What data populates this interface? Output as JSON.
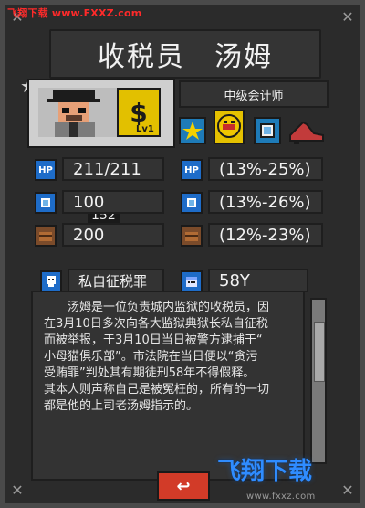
{
  "watermark_top": "飞翔下载 www.FXXZ.com",
  "character": {
    "name": "收税员　汤姆",
    "rank": "中级会计师",
    "hp_badge": "152",
    "level_symbol": "$",
    "level_label": "Lv1"
  },
  "stats_left": [
    {
      "icon": "HP",
      "value": "211/211"
    },
    {
      "icon": "",
      "value": "100"
    },
    {
      "icon": "",
      "value": "200"
    }
  ],
  "stats_right": [
    {
      "icon": "HP",
      "value": "(13%-25%)"
    },
    {
      "icon": "",
      "value": "(13%-26%)"
    },
    {
      "icon": "",
      "value": "(12%-23%)"
    }
  ],
  "crime": {
    "label": "私自征税罪",
    "sentence": "58Y"
  },
  "description": "　　汤姆是一位负责城内监狱的收税员，因\n在3月10日多次向各大监狱典狱长私自征税\n而被举报，于3月10日当日被警方逮捕于“\n小母猫俱乐部”。市法院在当日便以“贪污\n受贿罪”判处其有期徒刑58年不得假释。\n其本人则声称自己是被冤枉的，所有的一切\n都是他的上司老汤姆指示的。",
  "buttons": {
    "back": "↩"
  },
  "watermark_bottom": {
    "brand": "飞翔下载",
    "url": "www.fxxz.com"
  }
}
